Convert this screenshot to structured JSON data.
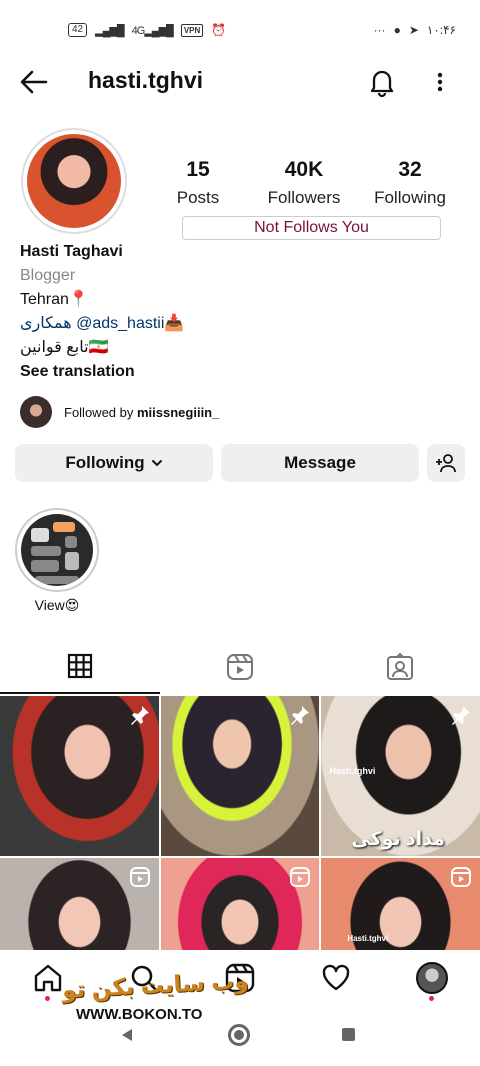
{
  "status_bar": {
    "battery": "42",
    "network_label": "4G",
    "vpn_label": "VPN",
    "time": "۱۰:۴۶",
    "more": "···"
  },
  "header": {
    "username": "hasti.tghvi"
  },
  "profile": {
    "stats": [
      {
        "value": "15",
        "label": "Posts"
      },
      {
        "value": "40K",
        "label": "Followers"
      },
      {
        "value": "32",
        "label": "Following"
      }
    ],
    "not_follows_label": "Not Follows You",
    "name": "Hasti Taghavi",
    "category": "Blogger",
    "city": "Tehran📍",
    "bio_line_1": "همکاری @ads_hastii📥",
    "bio_line_2": "تابع قوانین🇮🇷",
    "see_translation": "See translation",
    "followed_by_prefix": "Followed by ",
    "followed_by_user": "miissnegiiin_"
  },
  "actions": {
    "following_label": "Following",
    "message_label": "Message"
  },
  "highlights": [
    {
      "label": "View😍"
    }
  ],
  "grid_posts": [
    {
      "type": "pinned",
      "caption": ""
    },
    {
      "type": "pinned",
      "caption": ""
    },
    {
      "type": "pinned",
      "caption": "مداد نوکی",
      "subcaption": "Hasti.tghvi"
    },
    {
      "type": "reel",
      "caption": ""
    },
    {
      "type": "reel",
      "caption": ""
    },
    {
      "type": "reel",
      "caption": "",
      "subcaption": "Hasti.tghvi"
    }
  ],
  "watermark": {
    "text": "وب سایت بکن تو",
    "url": "WWW.BOKON.TO"
  },
  "colors": {
    "not_follows_text": "#7a1040",
    "button_bg": "#efefef",
    "link": "#00376b",
    "notification_dot": "#e0245e"
  }
}
